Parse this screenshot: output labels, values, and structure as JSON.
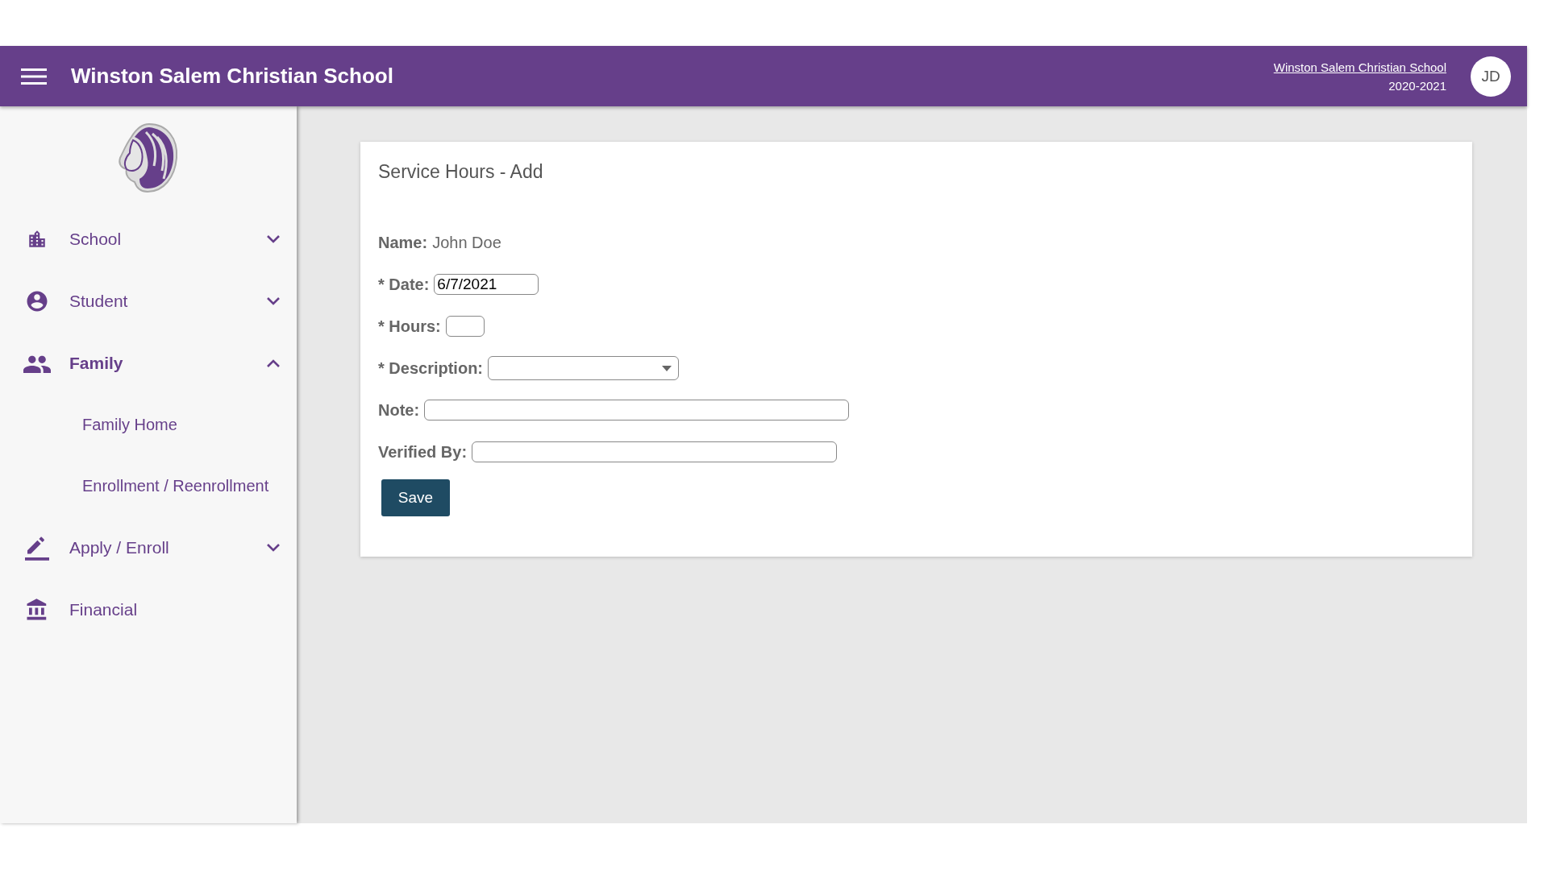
{
  "header": {
    "title": "Winston Salem Christian School",
    "school_link": "Winston Salem Christian School",
    "year": "2020-2021",
    "avatar_initials": "JD"
  },
  "sidebar": {
    "items": [
      {
        "label": "School",
        "kind": "group",
        "expanded": false,
        "selected": false
      },
      {
        "label": "Student",
        "kind": "group",
        "expanded": false,
        "selected": false
      },
      {
        "label": "Family",
        "kind": "group",
        "expanded": true,
        "selected": true,
        "children": [
          {
            "label": "Family Home"
          },
          {
            "label": "Enrollment / Reenrollment"
          }
        ]
      },
      {
        "label": "Apply / Enroll",
        "kind": "group",
        "expanded": false,
        "selected": false
      },
      {
        "label": "Financial",
        "kind": "link",
        "selected": false
      }
    ]
  },
  "card": {
    "title": "Service Hours - Add",
    "fields": [
      {
        "kind": "static",
        "label": "Name:",
        "value": "John Doe"
      },
      {
        "kind": "input",
        "label": "* Date:",
        "value": "6/7/2021"
      },
      {
        "kind": "input",
        "label": "* Hours:"
      },
      {
        "kind": "select",
        "label": "* Description:"
      },
      {
        "kind": "input",
        "label": "Note:"
      },
      {
        "kind": "input",
        "label": "Verified By:"
      }
    ],
    "button": "Save"
  }
}
